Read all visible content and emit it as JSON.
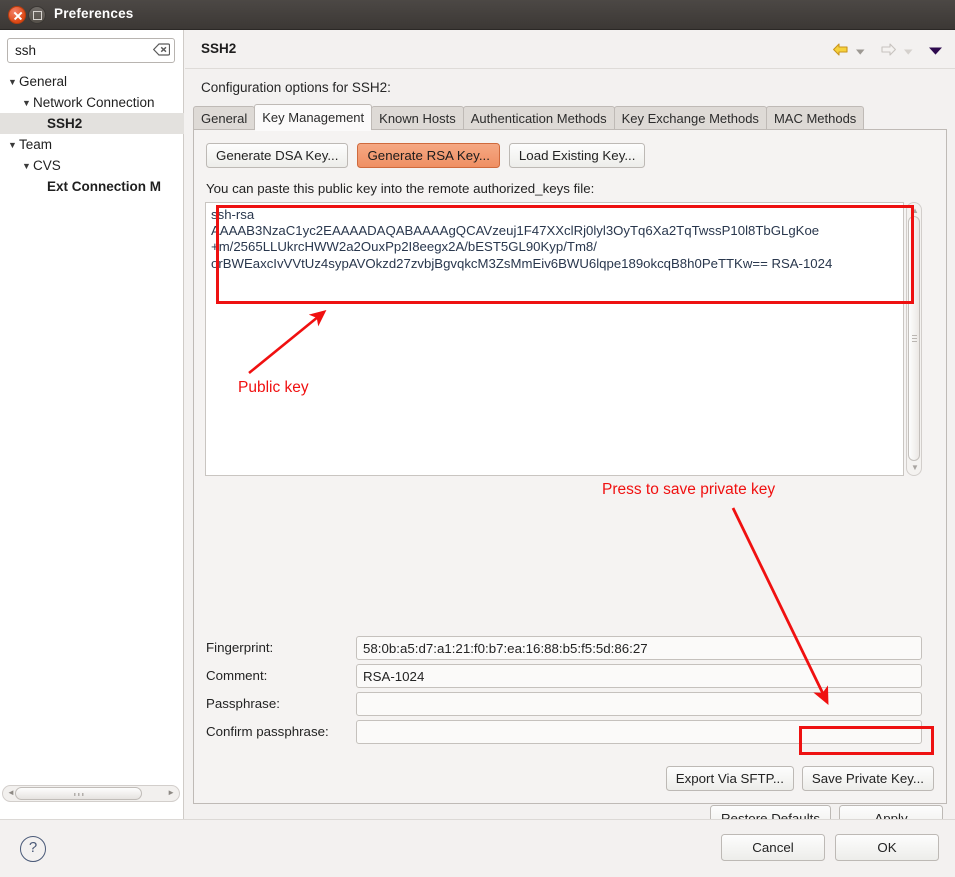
{
  "window": {
    "title": "Preferences",
    "close_icon": "close-icon",
    "maximize_icon": "maximize-icon"
  },
  "sidebar": {
    "search": {
      "value": "ssh",
      "placeholder": "type filter text",
      "clear_icon": "clear-search-icon"
    },
    "tree": [
      {
        "label": "General",
        "level": 0,
        "twisty": "▼",
        "selected": false,
        "bold": false
      },
      {
        "label": "Network Connection",
        "level": 1,
        "twisty": "▼",
        "selected": false,
        "bold": false
      },
      {
        "label": "SSH2",
        "level": 2,
        "twisty": "",
        "selected": true,
        "bold": true
      },
      {
        "label": "Team",
        "level": 0,
        "twisty": "▼",
        "selected": false,
        "bold": false
      },
      {
        "label": "CVS",
        "level": 1,
        "twisty": "▼",
        "selected": false,
        "bold": false
      },
      {
        "label": "Ext Connection M",
        "level": 2,
        "twisty": "",
        "selected": false,
        "bold": true
      }
    ],
    "hscroll": {
      "left_arrow": "scroll-left-arrow-icon",
      "right_arrow": "scroll-right-arrow-icon"
    }
  },
  "pane": {
    "title": "SSH2",
    "nav": {
      "back_icon": "back-arrow-icon",
      "back_dropdown_icon": "back-dropdown-icon",
      "forward_icon": "forward-arrow-icon",
      "forward_dropdown_icon": "forward-dropdown-icon",
      "menu_icon": "view-menu-icon"
    },
    "config_label": "Configuration options for SSH2:",
    "tabs": [
      {
        "label": "General",
        "active": false
      },
      {
        "label": "Key Management",
        "active": true
      },
      {
        "label": "Known Hosts",
        "active": false
      },
      {
        "label": "Authentication Methods",
        "active": false
      },
      {
        "label": "Key Exchange Methods",
        "active": false
      },
      {
        "label": "MAC Methods",
        "active": false
      }
    ]
  },
  "key_management": {
    "buttons": [
      {
        "label": "Generate DSA Key...",
        "highlighted": false
      },
      {
        "label": "Generate RSA Key...",
        "highlighted": true
      },
      {
        "label": "Load Existing Key...",
        "highlighted": false
      }
    ],
    "paste_label": "You can paste this public key into the remote authorized_keys file:",
    "public_key": "ssh-rsa\nAAAAB3NzaC1yc2EAAAADAQABAAAAgQCAVzeuj1F47XXclRj0lyl3OyTq6Xa2TqTwssP10l8TbGLgKoe\n+m/2565LLUkrcHWW2a2OuxPp2I8eegx2A/bEST5GL90Kyp/Tm8/\norBWEaxcIvVVtUz4sypAVOkzd27zvbjBgvqkcM3ZsMmEiv6BWU6lqpe189okcqB8h0PeTTKw== RSA-1024",
    "fields": [
      {
        "label": "Fingerprint:",
        "value": "58:0b:a5:d7:a1:21:f0:b7:ea:16:88:b5:f5:5d:86:27",
        "name": "fingerprint"
      },
      {
        "label": "Comment:",
        "value": "RSA-1024",
        "name": "comment"
      },
      {
        "label": "Passphrase:",
        "value": "",
        "name": "passphrase"
      },
      {
        "label": "Confirm passphrase:",
        "value": "",
        "name": "confirm-passphrase"
      }
    ],
    "export_button": "Export Via SFTP...",
    "save_private_key_button": "Save Private Key..."
  },
  "annotations": [
    {
      "text": "Public key",
      "color": "#f01010"
    },
    {
      "text": "Press to save private key",
      "color": "#f01010"
    }
  ],
  "footer": {
    "restore_defaults": "Restore Defaults",
    "apply": "Apply",
    "help_icon": "help-icon",
    "cancel": "Cancel",
    "ok": "OK"
  },
  "colors": {
    "annotation_red": "#f01010",
    "highlight_button": "#ef8f63",
    "selection_gray": "#e3e1de",
    "titlebar": "#3c3835"
  }
}
